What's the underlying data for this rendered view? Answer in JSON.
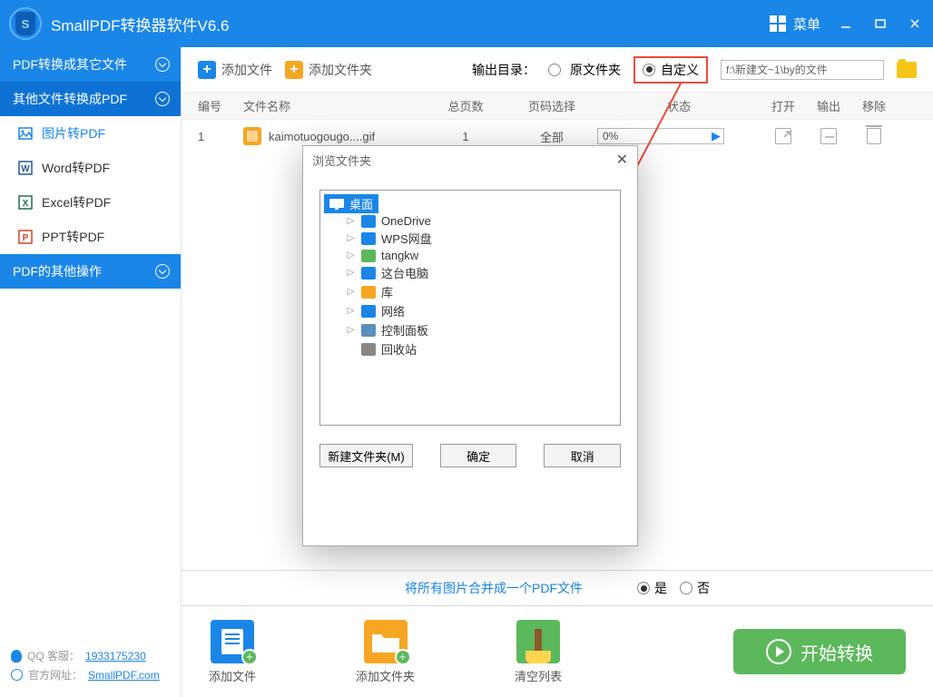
{
  "title": "SmallPDF转换器软件V6.6",
  "menu_label": "菜单",
  "sidebar": {
    "sections": [
      {
        "label": "PDF转换成其它文件"
      },
      {
        "label": "其他文件转换成PDF"
      },
      {
        "label": "PDF的其他操作"
      }
    ],
    "items": [
      {
        "label": "图片转PDF",
        "icon": "image"
      },
      {
        "label": "Word转PDF",
        "icon": "word"
      },
      {
        "label": "Excel转PDF",
        "icon": "excel"
      },
      {
        "label": "PPT转PDF",
        "icon": "ppt"
      }
    ],
    "footer": {
      "qq_label": "QQ 客服：",
      "qq_value": "1933175230",
      "site_label": "官方网址：",
      "site_value": "SmallPDF.com"
    }
  },
  "toolbar": {
    "add_file": "添加文件",
    "add_folder": "添加文件夹",
    "output_label": "输出目录：",
    "radio_source": "原文件夹",
    "radio_custom": "自定义",
    "path_value": "f:\\新建文~1\\by的文件"
  },
  "table": {
    "headers": {
      "num": "编号",
      "name": "文件名称",
      "pages": "总页数",
      "range": "页码选择",
      "status": "状态",
      "open": "打开",
      "out": "输出",
      "del": "移除"
    },
    "rows": [
      {
        "num": "1",
        "name": "kaimotuogougo....gif",
        "pages": "1",
        "range": "全部",
        "status": "0%"
      }
    ]
  },
  "option_bar": {
    "merge_label": "将所有图片合并成一个PDF文件",
    "yes": "是",
    "no": "否"
  },
  "bottom": {
    "add_file": "添加文件",
    "add_folder": "添加文件夹",
    "clear": "清空列表",
    "start": "开始转换"
  },
  "dialog": {
    "title": "浏览文件夹",
    "root": "桌面",
    "items": [
      {
        "label": "OneDrive",
        "color": "#1a86e7"
      },
      {
        "label": "WPS网盘",
        "color": "#1a86e7"
      },
      {
        "label": "tangkw",
        "color": "#5cb85c"
      },
      {
        "label": "这台电脑",
        "color": "#1a86e7"
      },
      {
        "label": "库",
        "color": "#f5a623"
      },
      {
        "label": "网络",
        "color": "#1a86e7"
      },
      {
        "label": "控制面板",
        "color": "#5c8fb8"
      },
      {
        "label": "回收站",
        "color": "#888"
      }
    ],
    "btn_new": "新建文件夹(M)",
    "btn_ok": "确定",
    "btn_cancel": "取消"
  }
}
